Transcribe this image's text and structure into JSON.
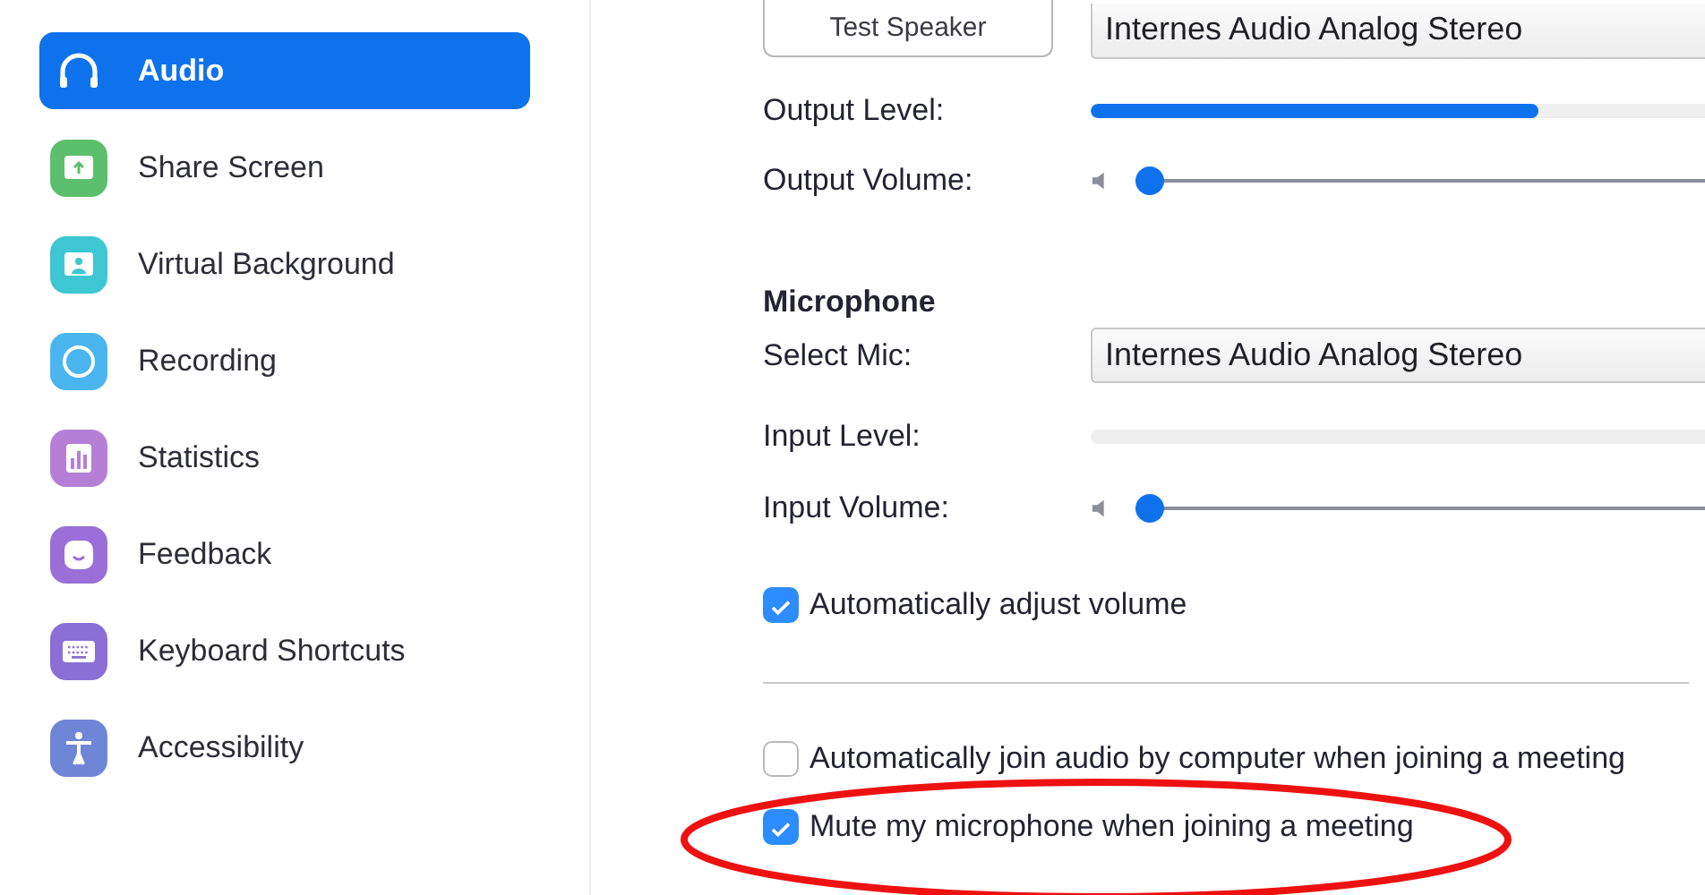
{
  "sidebar": {
    "items": [
      {
        "label": "Audio",
        "selected": true
      },
      {
        "label": "Share Screen",
        "selected": false
      },
      {
        "label": "Virtual Background",
        "selected": false
      },
      {
        "label": "Recording",
        "selected": false
      },
      {
        "label": "Statistics",
        "selected": false
      },
      {
        "label": "Feedback",
        "selected": false
      },
      {
        "label": "Keyboard Shortcuts",
        "selected": false
      },
      {
        "label": "Accessibility",
        "selected": false
      }
    ]
  },
  "speaker": {
    "test_button": "Test Speaker",
    "device": "Internes Audio Analog Stereo",
    "output_level_label": "Output Level:",
    "output_level": {
      "level": 0.73
    },
    "output_volume_label": "Output Volume:",
    "output_volume": {
      "level": 0
    }
  },
  "microphone": {
    "heading": "Microphone",
    "select_label": "Select Mic:",
    "device": "Internes Audio Analog Stereo",
    "input_level_label": "Input Level:",
    "input_volume_label": "Input Volume:",
    "input_volume": {
      "level": 0
    }
  },
  "auto_adjust": {
    "label": "Automatically adjust volume",
    "checked": true
  },
  "options": [
    {
      "label": "Automatically join audio by computer when joining a meeting",
      "checked": false
    },
    {
      "label": "Mute my microphone when joining a meeting",
      "checked": true
    }
  ],
  "annotation": {
    "kind": "ellipse"
  }
}
